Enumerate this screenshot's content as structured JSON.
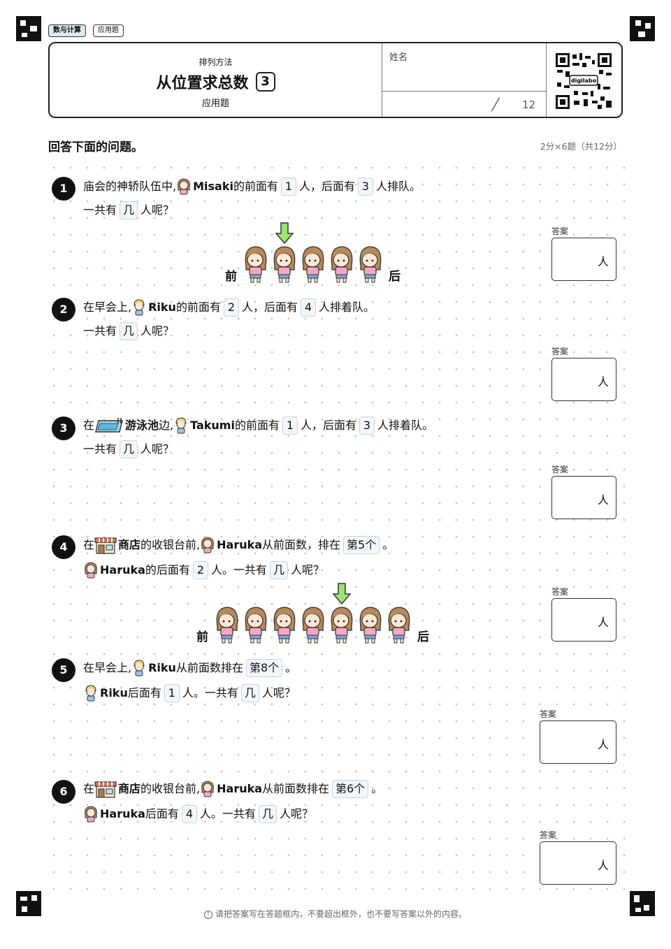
{
  "tags": [
    "数与计算",
    "应用题"
  ],
  "header": {
    "subtitle": "排列方法",
    "title": "从位置求总数",
    "number": "3",
    "kind": "应用题",
    "name_label": "姓名",
    "score_slash": "/",
    "score_total": "12",
    "qr_label": "digilabo"
  },
  "instruction": "回答下面的问题。",
  "points": "2分×6题（共12分）",
  "answer_label": "答案",
  "unit": "人",
  "front": "前",
  "back": "后",
  "questions": [
    {
      "num": "1",
      "l1": {
        "a": "庙会的神轿队伍中,",
        "name": "Misaki",
        "b": "的前面有",
        "v1": "1",
        "c": "人，后面有",
        "v2": "3",
        "d": "人排队。"
      },
      "l2": {
        "a": "一共有",
        "v": "几",
        "b": "人呢？"
      }
    },
    {
      "num": "2",
      "l1": {
        "a": "在早会上,",
        "name": "Riku",
        "b": "的前面有",
        "v1": "2",
        "c": "人，后面有",
        "v2": "4",
        "d": "人排着队。"
      },
      "l2": {
        "a": "一共有",
        "v": "几",
        "b": "人呢？"
      }
    },
    {
      "num": "3",
      "l1": {
        "a": "在",
        "place": "游泳池",
        "a2": "边,",
        "name": "Takumi",
        "b": "的前面有",
        "v1": "1",
        "c": "人，后面有",
        "v2": "3",
        "d": "人排着队。"
      },
      "l2": {
        "a": "一共有",
        "v": "几",
        "b": "人呢？"
      }
    },
    {
      "num": "4",
      "l1": {
        "a": "在",
        "place": "商店",
        "a2": "的收银台前,",
        "name": "Haruka",
        "b": "从前面数，排在",
        "v1": "第5个",
        "c": "。"
      },
      "l2": {
        "name": "Haruka",
        "a": "的后面有",
        "v1": "2",
        "b": "人。一共有",
        "v2": "几",
        "c": "人呢？"
      }
    },
    {
      "num": "5",
      "l1": {
        "a": "在早会上,",
        "name": "Riku",
        "b": "从前面数排在",
        "v1": "第8个",
        "c": "。"
      },
      "l2": {
        "name": "Riku",
        "a": "后面有",
        "v1": "1",
        "b": "人。一共有",
        "v2": "几",
        "c": "人呢？"
      }
    },
    {
      "num": "6",
      "l1": {
        "a": "在",
        "place": "商店",
        "a2": "的收银台前,",
        "name": "Haruka",
        "b": "从前面数排在",
        "v1": "第6个",
        "c": "。"
      },
      "l2": {
        "name": "Haruka",
        "a": "后面有",
        "v1": "4",
        "b": "人。一共有",
        "v2": "几",
        "c": "人呢？"
      }
    }
  ],
  "footer": "请把答案写在答题框内，不要超出框外，也不要写答案以外的内容。",
  "colors": {
    "girl_hair": "#b8895a",
    "girl_shirt": "#f3a8c4",
    "boy_hair": "#f2d36b",
    "boy_shirt": "#9cc3ea",
    "arrow": "#9ee36f",
    "box_border": "#c5d4e6"
  }
}
